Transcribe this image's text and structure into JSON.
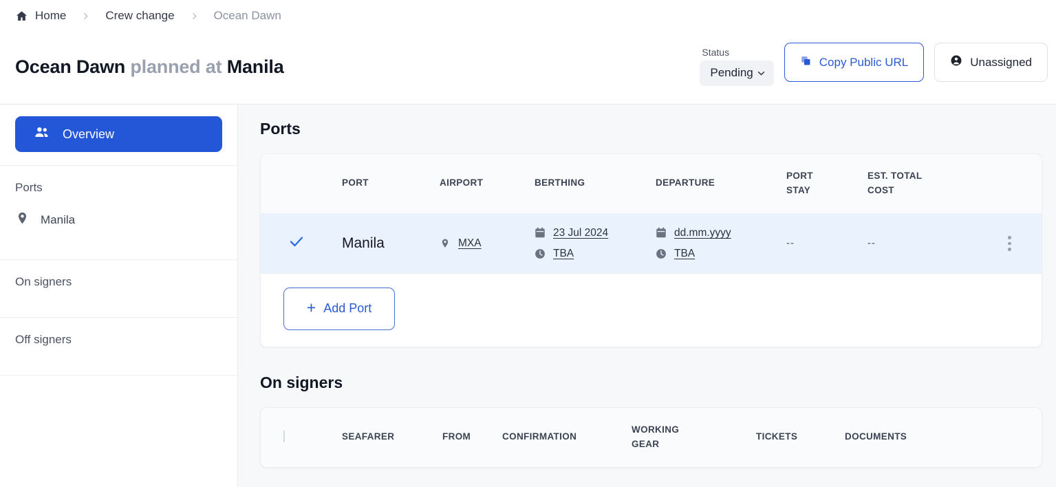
{
  "breadcrumb": {
    "home_icon": "home-icon",
    "items": [
      {
        "label": "Home"
      },
      {
        "label": "Crew change"
      },
      {
        "label": "Ocean Dawn"
      }
    ],
    "separator": "›"
  },
  "page_title": {
    "vessel": "Ocean Dawn",
    "connector": "planned at",
    "port": "Manila"
  },
  "header": {
    "status_label": "Status",
    "status_value": "Pending",
    "status_chevron": "⌄",
    "copy_url_button": "Copy Public URL",
    "copy_icon": "copy-icon",
    "assignee_button": "Unassigned",
    "assignee_icon": "account-circle-icon"
  },
  "sidebar": {
    "active_item": {
      "label": "Overview",
      "icon": "people-icon"
    },
    "ports_label": "Ports",
    "port_items": [
      {
        "label": "Manila",
        "icon": "location-pin-icon"
      }
    ],
    "items": [
      {
        "label": "On signers"
      },
      {
        "label": "Off signers"
      }
    ]
  },
  "ports_section": {
    "title": "Ports",
    "columns": [
      "",
      "PORT",
      "AIRPORT",
      "BERTHING",
      "DEPARTURE",
      "PORT STAY",
      "EST. TOTAL COST",
      ""
    ],
    "column_labels": {
      "port": "PORT",
      "airport": "AIRPORT",
      "berthing": "BERTHING",
      "departure": "DEPARTURE",
      "port_stay_line1": "PORT",
      "port_stay_line2": "STAY",
      "cost_line1": "EST. TOTAL",
      "cost_line2": "COST"
    },
    "rows": [
      {
        "selected_icon": "✓",
        "port": "Manila",
        "airport": "MXA",
        "airport_icon": "location-pin-icon",
        "berthing_date": "23 Jul 2024",
        "berthing_time": "TBA",
        "departure_date": "dd.mm.yyyy",
        "departure_time": "TBA",
        "port_stay": "--",
        "est_total_cost": "--",
        "menu_icon": "kebab-menu-icon",
        "calendar_icon": "calendar-icon",
        "clock_icon": "clock-icon"
      }
    ],
    "add_port_button": "Add Port",
    "add_icon": "+"
  },
  "on_signers_section": {
    "title": "On signers",
    "column_labels": {
      "seafarer": "SEAFARER",
      "from": "FROM",
      "confirmation": "CONFIRMATION",
      "gear_line1": "WORKING",
      "gear_line2": "GEAR",
      "tickets": "TICKETS",
      "documents": "DOCUMENTS"
    },
    "select_all_checkbox": "select-all-checkbox"
  },
  "colors": {
    "accent_blue": "#2456d8",
    "link_blue": "#2b59d4",
    "row_selected": "#eaf2fd",
    "page_bg": "#f7f8fa",
    "muted_text": "#99a0ae"
  }
}
